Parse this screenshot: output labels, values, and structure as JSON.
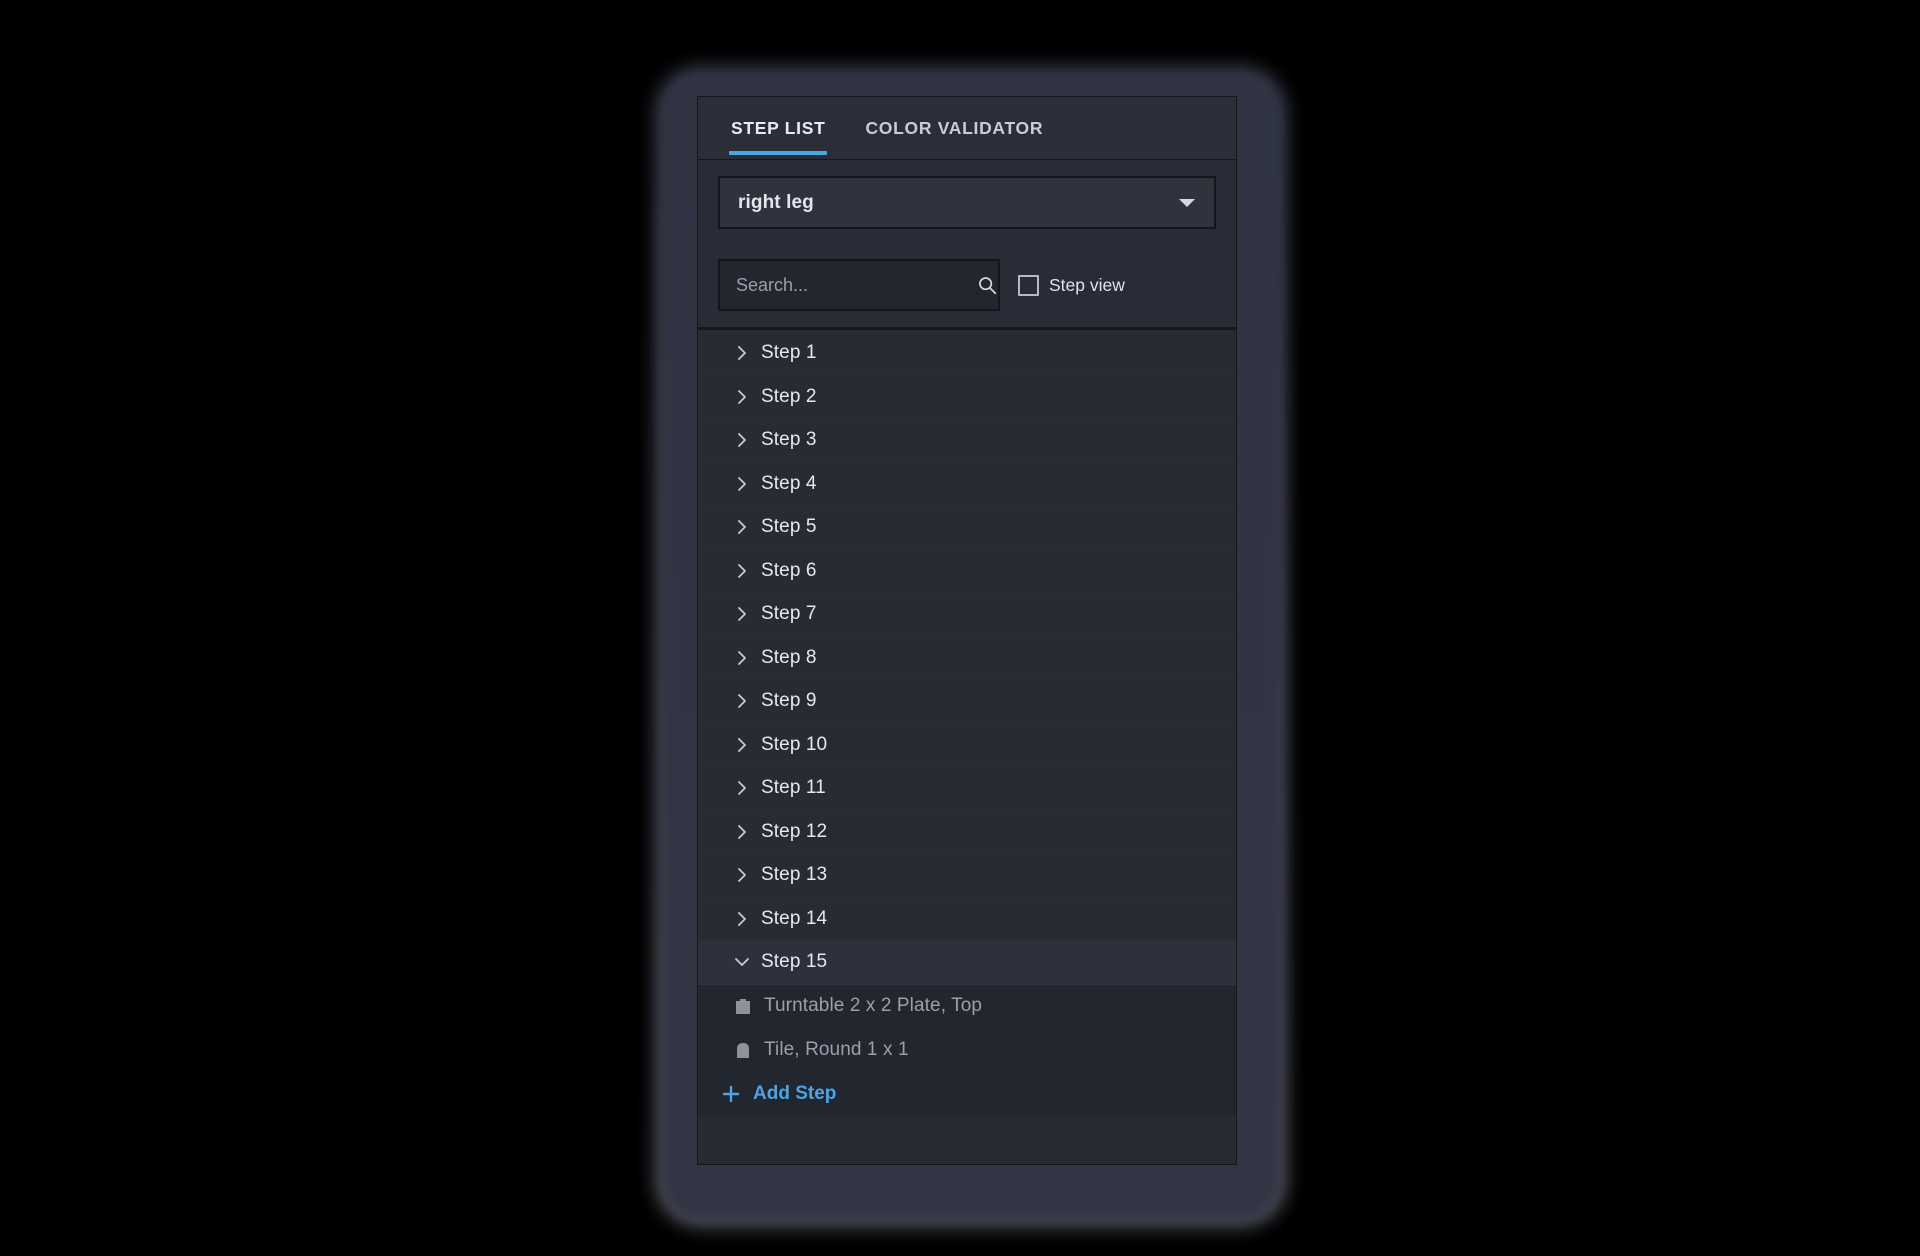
{
  "panel": {
    "tabs": [
      {
        "label": "STEP LIST",
        "active": true
      },
      {
        "label": "COLOR VALIDATOR",
        "active": false
      }
    ],
    "selector": {
      "value": "right leg",
      "icon": "chevron-down-icon"
    },
    "search": {
      "placeholder": "Search...",
      "value": "",
      "icon": "search-icon"
    },
    "step_view_checkbox": {
      "label": "Step view",
      "checked": false
    },
    "steps": [
      {
        "label": "Step 1",
        "expanded": false
      },
      {
        "label": "Step 2",
        "expanded": false
      },
      {
        "label": "Step 3",
        "expanded": false
      },
      {
        "label": "Step 4",
        "expanded": false
      },
      {
        "label": "Step 5",
        "expanded": false
      },
      {
        "label": "Step 6",
        "expanded": false
      },
      {
        "label": "Step 7",
        "expanded": false
      },
      {
        "label": "Step 8",
        "expanded": false
      },
      {
        "label": "Step 9",
        "expanded": false
      },
      {
        "label": "Step 10",
        "expanded": false
      },
      {
        "label": "Step 11",
        "expanded": false
      },
      {
        "label": "Step 12",
        "expanded": false
      },
      {
        "label": "Step 13",
        "expanded": false
      },
      {
        "label": "Step 14",
        "expanded": false
      },
      {
        "label": "Step 15",
        "expanded": true
      }
    ],
    "expanded_step_parts": [
      {
        "label": "Turntable 2 x 2 Plate, Top",
        "icon": "brick-part-icon"
      },
      {
        "label": "Tile, Round 1 x 1",
        "icon": "round-part-icon"
      }
    ],
    "add_step": {
      "label": "Add Step",
      "icon": "plus-icon"
    }
  },
  "colors": {
    "accent": "#4fa8dc",
    "link": "#4fa3e3",
    "panel_bg": "#292d38",
    "list_bg": "#272b34",
    "sub_bg": "#22262f",
    "highlight_row": "#2d313c",
    "text_primary": "#e6e9ee",
    "text_muted": "#9ba0aa"
  }
}
